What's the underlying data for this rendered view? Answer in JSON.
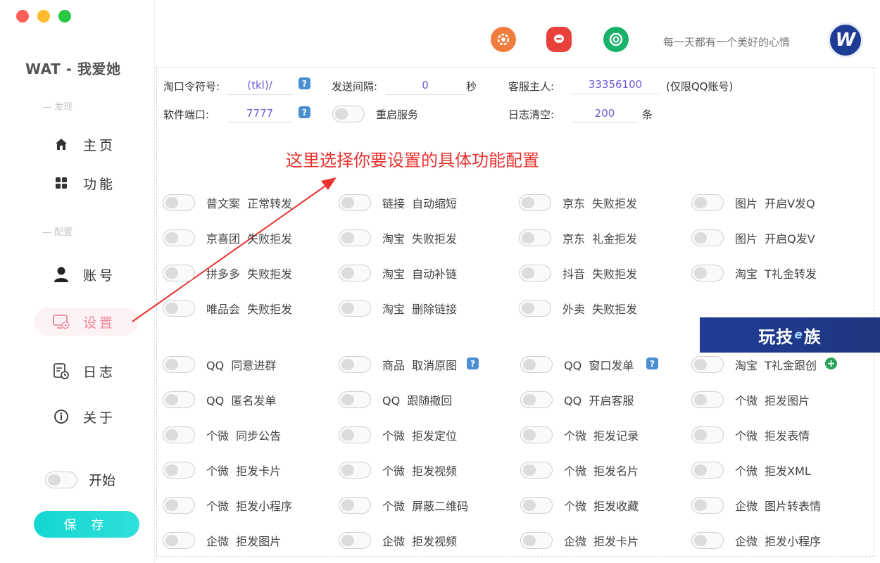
{
  "app": {
    "title": "WAT - 我爱她"
  },
  "sidebar": {
    "section_discover": "— 发现",
    "section_config": "— 配置",
    "items": [
      {
        "label": "主页",
        "icon": "home-icon"
      },
      {
        "label": "功能",
        "icon": "grid-icon"
      },
      {
        "label": "账号",
        "icon": "user-icon"
      },
      {
        "label": "设置",
        "icon": "settings-monitor-icon",
        "active": true
      },
      {
        "label": "日志",
        "icon": "log-clock-icon"
      },
      {
        "label": "关于",
        "icon": "info-icon"
      }
    ],
    "start_label": "开始",
    "save_label": "保 存"
  },
  "header": {
    "icons": [
      "orange-settings-icon",
      "red-chat-icon",
      "green-shutter-icon"
    ],
    "motto": "每一天都有一个美好的心情",
    "avatar_text": "W"
  },
  "settings": {
    "tkl_label": "淘口令符号:",
    "tkl_value": "(tkl)/",
    "interval_label": "发送间隔:",
    "interval_value": "0",
    "interval_unit": "秒",
    "owner_label": "客服主人:",
    "owner_value": "33356100",
    "owner_note": "(仅限QQ账号)",
    "port_label": "软件端口:",
    "port_value": "7777",
    "restart_label": "重启服务",
    "log_label": "日志清空:",
    "log_value": "200",
    "log_unit": "条"
  },
  "annotation": "这里选择你要设置的具体功能配置",
  "watermark": {
    "left": "玩技",
    "e": "e",
    "right": "族"
  },
  "group1": [
    "普文案  正常转发",
    "链接  自动缩短",
    "京东  失败拒发",
    "图片  开启V发Q",
    "京喜团  失败拒发",
    "淘宝  失败拒发",
    "京东  礼金拒发",
    "图片  开启Q发V",
    "拼多多  失败拒发",
    "淘宝  自动补链",
    "抖音  失败拒发",
    "淘宝  T礼金转发",
    "唯品会  失败拒发",
    "淘宝  删除链接",
    "外卖  失败拒发"
  ],
  "group2": [
    "QQ  同意进群",
    "商品  取消原图",
    "QQ  窗口发单",
    "淘宝  T礼金跟创",
    "QQ  匿名发单",
    "QQ  跟随撤回",
    "QQ  开启客服",
    "个微  拒发图片",
    "个微  同步公告",
    "个微  拒发定位",
    "个微  拒发记录",
    "个微  拒发表情",
    "个微  拒发卡片",
    "个微  拒发视频",
    "个微  拒发名片",
    "个微  拒发XML",
    "个微  拒发小程序",
    "个微  屏蔽二维码",
    "个微  拒发收藏",
    "企微  图片转表情",
    "企微  拒发图片",
    "企微  拒发视频",
    "企微  拒发卡片",
    "企微  拒发小程序"
  ],
  "colors": {
    "accent": "#14d6d0",
    "active": "#ef8a9c",
    "value": "#6b5ad8",
    "annotation": "#e8322e"
  }
}
